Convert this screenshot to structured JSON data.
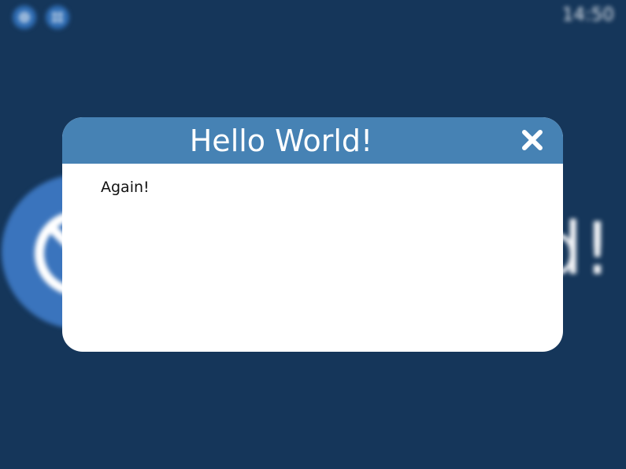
{
  "status_bar": {
    "time": "14:50",
    "settings_icon": "settings-icon",
    "apps_icon": "apps-icon"
  },
  "background": {
    "big_text": "d!",
    "circle_icon": "blocked-icon"
  },
  "dialog": {
    "title": "Hello World!",
    "message": "Again!",
    "close_icon": "close-icon"
  },
  "colors": {
    "screen_background": "#15365a",
    "dialog_header": "#4682b4",
    "dialog_body": "#ffffff",
    "accent_circle": "#3a74bd"
  }
}
